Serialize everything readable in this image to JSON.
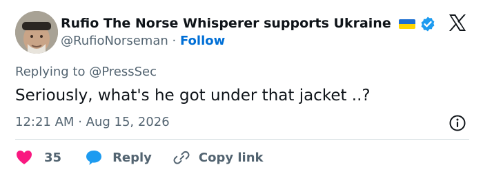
{
  "author": {
    "display_name": "Rufio The Norse Whisperer supports Ukraine",
    "handle": "@RufioNorseman",
    "separator": "·",
    "follow_label": "Follow",
    "avatar_icon": "avatar-photo",
    "flag_icon": "ukraine-flag-icon",
    "verified_icon": "verified-badge-icon"
  },
  "platform_logo": "x-logo-icon",
  "reply_context": {
    "text": "Replying to @PressSec"
  },
  "tweet": {
    "text": "Seriously, what's he got under that jacket ..?",
    "time": "12:21 AM",
    "separator": "·",
    "date": "Aug 15, 2026"
  },
  "actions": {
    "like_count": "35",
    "reply_label": "Reply",
    "copy_link_label": "Copy link"
  },
  "colors": {
    "text": "#0f1419",
    "secondary_text": "#536471",
    "link_blue": "#006fd6",
    "like_red": "#f91880",
    "reply_blue": "#1d9bf0",
    "verified_blue": "#1d9bf0",
    "divider": "#cfd9de"
  }
}
